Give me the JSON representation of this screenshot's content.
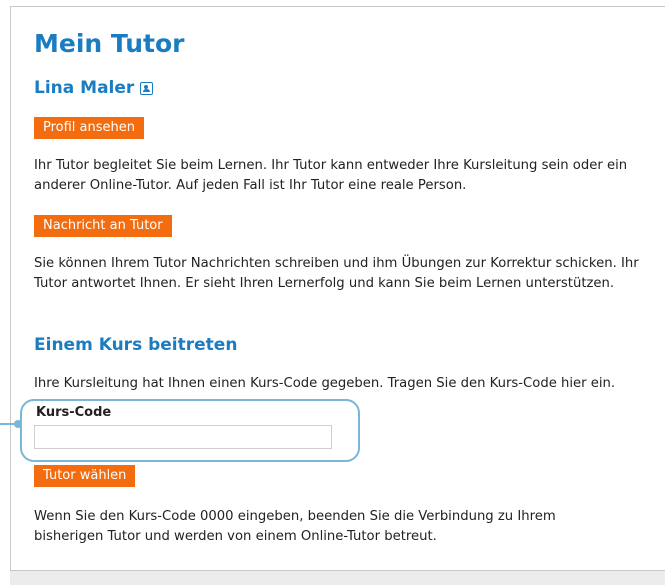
{
  "page": {
    "title": "Mein Tutor"
  },
  "tutor": {
    "name": "Lina Maler",
    "contact_icon": "contact-card-icon"
  },
  "actions": {
    "profile_label": "Profil ansehen",
    "message_label": "Nachricht an Tutor",
    "choose_label": "Tutor wählen"
  },
  "texts": {
    "intro": "Ihr Tutor begleitet Sie beim Lernen. Ihr Tutor kann entweder Ihre Kursleitung sein oder ein anderer Online-Tutor. Auf jeden Fall ist Ihr Tutor eine reale Person.",
    "messaging": "Sie können Ihrem Tutor Nachrichten schreiben und ihm Übungen zur Korrektur schicken. Ihr Tutor antwortet Ihnen. Er sieht Ihren Lernerfolg und kann Sie beim Lernen unterstützen.",
    "course_hint": "Ihre Kursleitung hat Ihnen einen Kurs-Code gegeben. Tragen Sie den Kurs-Code hier ein.",
    "reset_hint": "Wenn Sie den Kurs-Code 0000 eingeben, beenden Sie die Verbindung zu Ihrem bisherigen Tutor und werden von einem Online-Tutor betreut."
  },
  "join_course": {
    "heading": "Einem Kurs beitreten",
    "field_label": "Kurs-Code",
    "field_value": "",
    "field_placeholder": ""
  },
  "colors": {
    "heading_blue": "#1b7dc1",
    "button_orange": "#f36c0f",
    "highlight": "#79b6d8"
  }
}
